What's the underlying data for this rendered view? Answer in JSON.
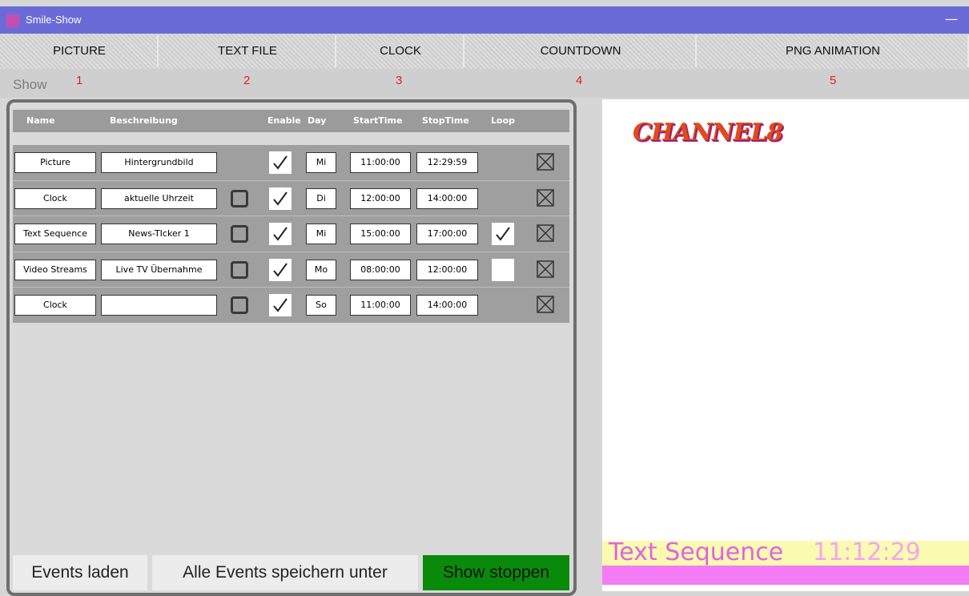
{
  "window": {
    "title": "Smile-Show",
    "minimize": "—"
  },
  "tabs": [
    "PICTURE",
    "TEXT FILE",
    "CLOCK",
    "COUNTDOWN",
    "PNG ANIMATION"
  ],
  "subheader": {
    "show_label": "Show",
    "numbers": [
      "1",
      "2",
      "3",
      "4",
      "5"
    ]
  },
  "table": {
    "headers": {
      "name": "Name",
      "description": "Beschreibung",
      "enable": "Enable",
      "day": "Day",
      "start": "StartTime",
      "stop": "StopTime",
      "loop": "Loop"
    },
    "rows": [
      {
        "name": "Picture",
        "description": "Hintergrundbild",
        "has_square": false,
        "enable": true,
        "day": "Mi",
        "start": "11:00:00",
        "stop": "12:29:59",
        "loop": null
      },
      {
        "name": "Clock",
        "description": "aktuelle Uhrzeit",
        "has_square": true,
        "enable": true,
        "day": "Di",
        "start": "12:00:00",
        "stop": "14:00:00",
        "loop": null
      },
      {
        "name": "Text Sequence",
        "description": "News-TIcker 1",
        "has_square": true,
        "enable": true,
        "day": "Mi",
        "start": "15:00:00",
        "stop": "17:00:00",
        "loop": true
      },
      {
        "name": "Video Streams",
        "description": "Live TV Übernahme",
        "has_square": true,
        "enable": true,
        "day": "Mo",
        "start": "08:00:00",
        "stop": "12:00:00",
        "loop": false
      },
      {
        "name": "Clock",
        "description": "",
        "has_square": true,
        "enable": true,
        "day": "So",
        "start": "11:00:00",
        "stop": "14:00:00",
        "loop": null
      }
    ]
  },
  "buttons": {
    "load": "Events laden",
    "save_as": "Alle Events speichern unter",
    "stop": "Show stoppen"
  },
  "preview": {
    "logo": "CHANNEL8",
    "ticker_text": "Text Sequence",
    "ticker_time": "11:12:29"
  },
  "colors": {
    "titlebar": "#6b6bd8",
    "stop_button": "#0a8a0a",
    "ticker_bg": "#fafab0",
    "ticker_bar": "#f47cf4",
    "tab_numbers": "#e02020"
  }
}
